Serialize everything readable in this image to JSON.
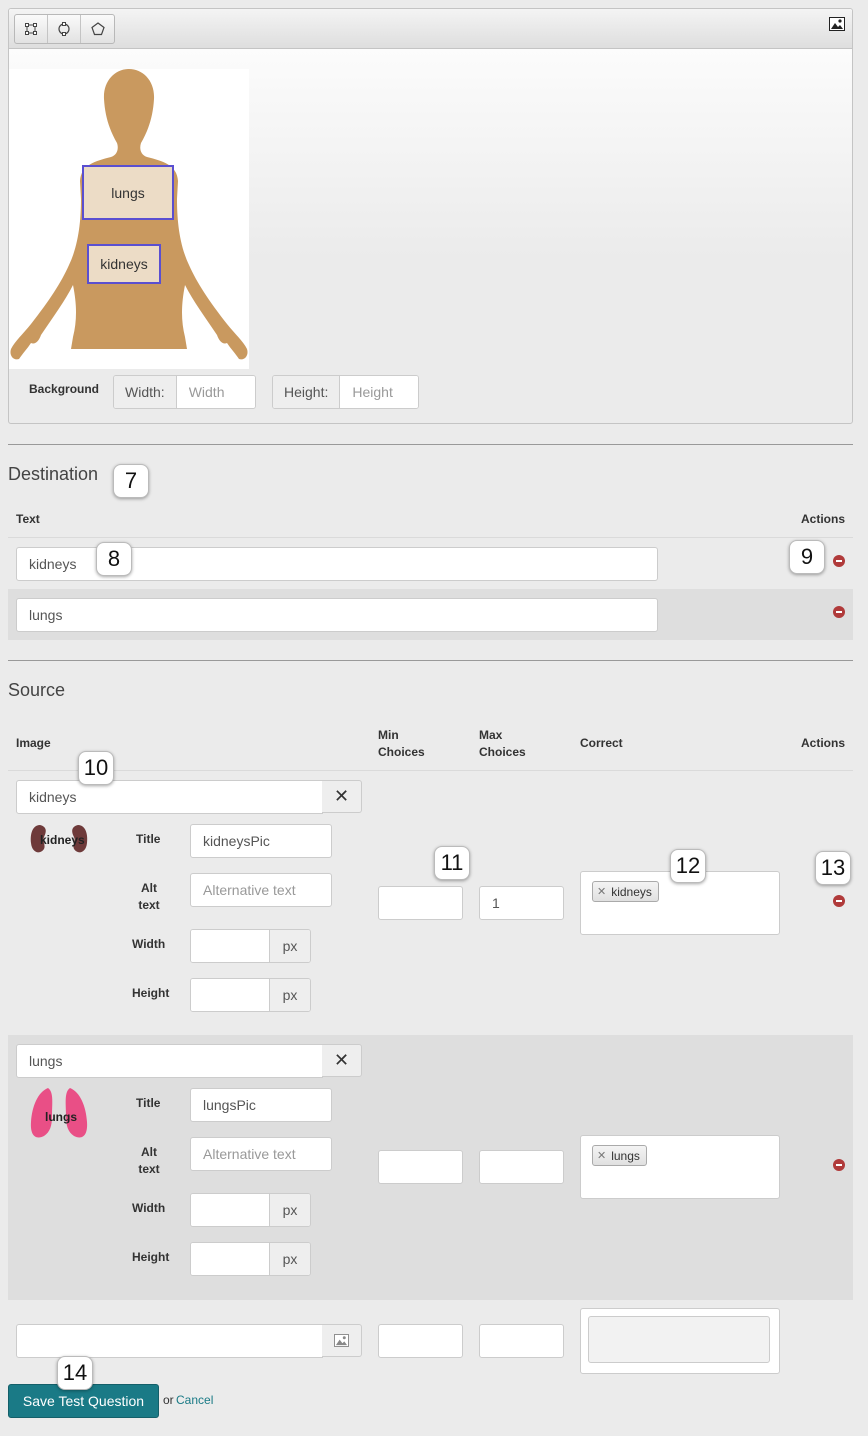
{
  "editor": {
    "tools": [
      {
        "icon": "rectangle-tool-icon"
      },
      {
        "icon": "circle-tool-icon"
      },
      {
        "icon": "polygon-tool-icon"
      }
    ],
    "picture_icon": "picture-icon",
    "hotspots": [
      {
        "label": "lungs"
      },
      {
        "label": "kidneys"
      }
    ],
    "background_label": "Background",
    "width_addon": "Width:",
    "width_placeholder": "Width",
    "height_addon": "Height:",
    "height_placeholder": "Height"
  },
  "destination": {
    "title": "Destination",
    "col_text": "Text",
    "col_actions": "Actions",
    "rows": [
      {
        "value": "kidneys"
      },
      {
        "value": "lungs"
      }
    ]
  },
  "source": {
    "title": "Source",
    "col_image": "Image",
    "col_min_choices": "Min Choices",
    "col_max_choices": "Max Choices",
    "col_correct": "Correct",
    "col_actions": "Actions",
    "labels": {
      "title": "Title",
      "alt_text": "Alt text",
      "width": "Width",
      "height": "Height",
      "px": "px",
      "alt_placeholder": "Alternative text"
    },
    "rows": [
      {
        "name": "kidneys",
        "thumb_label": "kidneys",
        "title_value": "kidneysPic",
        "min_choices": "",
        "max_choices": "1",
        "correct": [
          "kidneys"
        ]
      },
      {
        "name": "lungs",
        "thumb_label": "lungs",
        "title_value": "lungsPic",
        "min_choices": "",
        "max_choices": "",
        "correct": [
          "lungs"
        ]
      }
    ]
  },
  "annotations": [
    "7",
    "8",
    "9",
    "10",
    "11",
    "12",
    "13",
    "14"
  ],
  "footer": {
    "save_label": "Save Test Question",
    "or_text": "or",
    "cancel_label": "Cancel"
  },
  "colors": {
    "primary_button": "#1a7a86",
    "hotspot_border": "#5a4fd1",
    "remove_icon": "#b03a3a",
    "body_silhouette": "#c9995f"
  }
}
